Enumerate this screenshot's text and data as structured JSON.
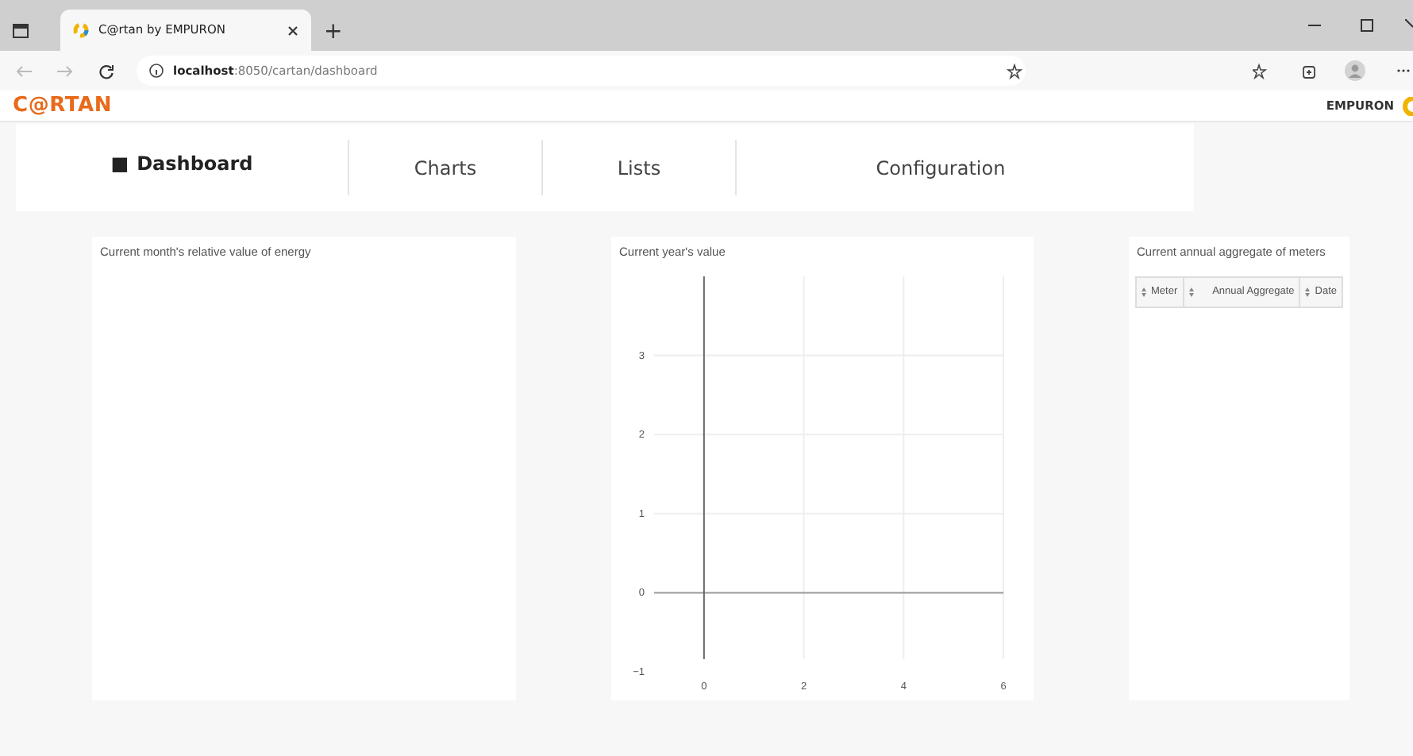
{
  "browser": {
    "tab_title": "C@rtan by EMPURON",
    "new_tab": "+",
    "url_host": "localhost",
    "url_path": ":8050/cartan/dashboard"
  },
  "header": {
    "logo": "C@RTAN",
    "partner_logo": "EMPURON"
  },
  "nav": [
    {
      "label": "Dashboard",
      "marker": "■",
      "selected": true
    },
    {
      "label": "Charts",
      "selected": false
    },
    {
      "label": "Lists",
      "selected": false
    },
    {
      "label": "Configuration",
      "selected": false
    }
  ],
  "panels": [
    {
      "kind": "empty",
      "title": "Current month's relative value of energy"
    },
    {
      "kind": "chart",
      "title": "Current year's value",
      "chart_data": {
        "type": "line",
        "grid": true,
        "xlim": [
          -1,
          6
        ],
        "ylim": [
          -1,
          4
        ],
        "xticks": [
          0,
          2,
          4,
          6
        ],
        "yticks": [
          -1,
          0,
          1,
          2,
          3
        ]
      }
    },
    {
      "kind": "table",
      "title": "Current annual aggregate of meters",
      "columns": [
        "Meter",
        "Annual Aggregate",
        "Date"
      ]
    }
  ]
}
